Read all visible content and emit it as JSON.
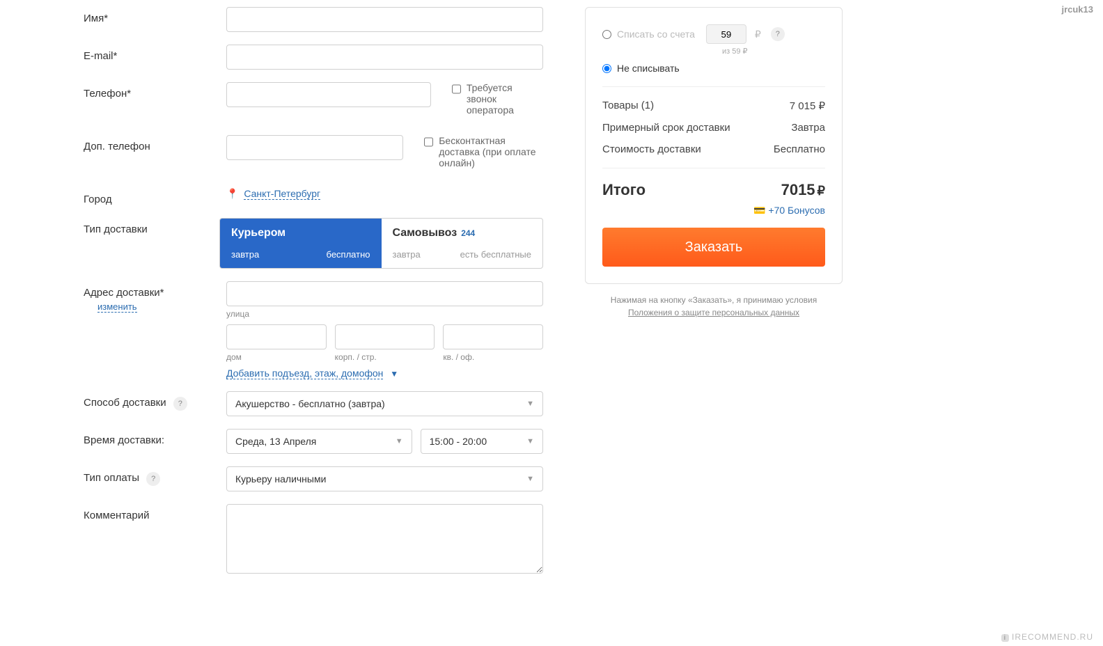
{
  "form": {
    "name_label": "Имя*",
    "email_label": "E-mail*",
    "phone_label": "Телефон*",
    "phone2_label": "Доп. телефон",
    "cb_call": "Требуется звонок оператора",
    "cb_contactless": "Бесконтактная доставка (при оплате онлайн)",
    "city_label": "Город",
    "city_value": "Санкт-Петербург",
    "delivery_type_label": "Тип доставки",
    "tab_courier": {
      "title": "Курьером",
      "sub1": "завтра",
      "sub2": "бесплатно"
    },
    "tab_pickup": {
      "title": "Самовывоз",
      "count": "244",
      "sub1": "завтра",
      "sub2": "есть бесплатные"
    },
    "address_label": "Адрес доставки*",
    "address_change": "изменить",
    "street_label": "улица",
    "house_label": "дом",
    "korp_label": "корп. / стр.",
    "apt_label": "кв. / оф.",
    "add_entrance": "Добавить подъезд, этаж, домофон",
    "delivery_method_label": "Способ доставки",
    "delivery_method_value": "Акушерство - бесплатно (завтра)",
    "delivery_time_label": "Время доставки:",
    "delivery_date_value": "Среда, 13 Апреля",
    "delivery_time_value": "15:00 - 20:00",
    "payment_label": "Тип оплаты",
    "payment_value": "Курьеру наличными",
    "comment_label": "Комментарий"
  },
  "summary": {
    "debit_label": "Списать со счета",
    "points_value": "59",
    "points_sub": "из 59 ₽",
    "nodebit_label": "Не списывать",
    "goods_label": "Товары (1)",
    "goods_value": "7 015 ₽",
    "eta_label": "Примерный срок доставки",
    "eta_value": "Завтра",
    "shipcost_label": "Стоимость доставки",
    "shipcost_value": "Бесплатно",
    "total_label": "Итого",
    "total_value": "7015",
    "total_rub": "₽",
    "bonus_text": "+70 Бонусов",
    "order_btn": "Заказать",
    "agree1": "Нажимая на кнопку «Заказать», я принимаю условия",
    "agree2": "Положения о защите персональных данных"
  },
  "watermark": {
    "user": "jrcuk13",
    "site": "IRECOMMEND.RU",
    "badge": "i"
  }
}
